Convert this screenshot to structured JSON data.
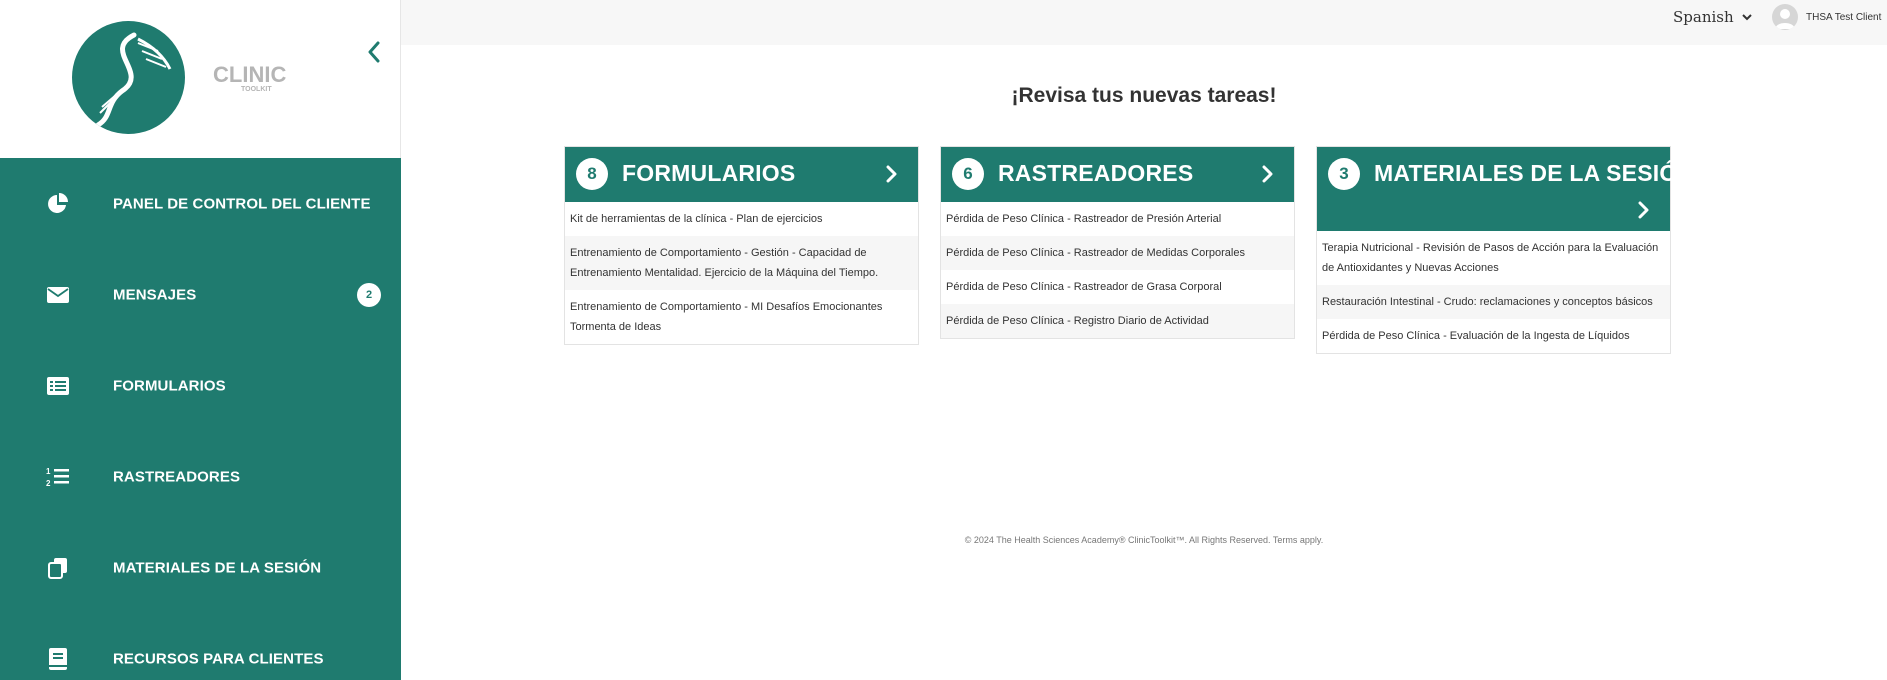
{
  "brand": {
    "logo_text": "CLINIC",
    "logo_subtext": "TOOLKIT"
  },
  "topbar": {
    "language": "Spanish",
    "user_name": "THSA Test Client"
  },
  "sidebar": {
    "items": [
      {
        "label": "PANEL DE CONTROL DEL CLIENTE",
        "icon": "pie-chart-icon"
      },
      {
        "label": "MENSAJES",
        "icon": "envelope-icon",
        "badge": "2"
      },
      {
        "label": "FORMULARIOS",
        "icon": "form-list-icon"
      },
      {
        "label": "RASTREADORES",
        "icon": "numbered-list-icon"
      },
      {
        "label": "MATERIALES DE LA SESIÓN",
        "icon": "copy-icon"
      },
      {
        "label": "RECURSOS PARA CLIENTES",
        "icon": "book-icon"
      }
    ]
  },
  "main": {
    "title": "¡Revisa tus nuevas tareas!",
    "cards": [
      {
        "count": "8",
        "title": "FORMULARIOS",
        "items": [
          "Kit de herramientas de la clínica - Plan de ejercicios",
          "Entrenamiento de Comportamiento - Gestión - Capacidad de Entrenamiento Mentalidad. Ejercicio de la Máquina del Tiempo.",
          "Entrenamiento de Comportamiento - MI Desafíos Emocionantes Tormenta de Ideas"
        ]
      },
      {
        "count": "6",
        "title": "RASTREADORES",
        "items": [
          "Pérdida de Peso Clínica - Rastreador de Presión Arterial",
          "Pérdida de Peso Clínica - Rastreador de Medidas Corporales",
          "Pérdida de Peso Clínica - Rastreador de Grasa Corporal",
          "Pérdida de Peso Clínica - Registro Diario de Actividad"
        ]
      },
      {
        "count": "3",
        "title": "MATERIALES DE LA SESIÓN",
        "items": [
          "Terapia Nutricional - Revisión de Pasos de Acción para la Evaluación de Antioxidantes y Nuevas Acciones",
          "Restauración Intestinal - Crudo: reclamaciones y conceptos básicos",
          "Pérdida de Peso Clínica - Evaluación de la Ingesta de Líquidos"
        ]
      }
    ]
  },
  "footer": {
    "text": "© 2024 The Health Sciences Academy® ClinicToolkit™. All Rights Reserved.",
    "terms_link": "Terms apply."
  },
  "colors": {
    "brand_teal": "#1f7b6f",
    "sidebar_text": "#ffffff"
  }
}
